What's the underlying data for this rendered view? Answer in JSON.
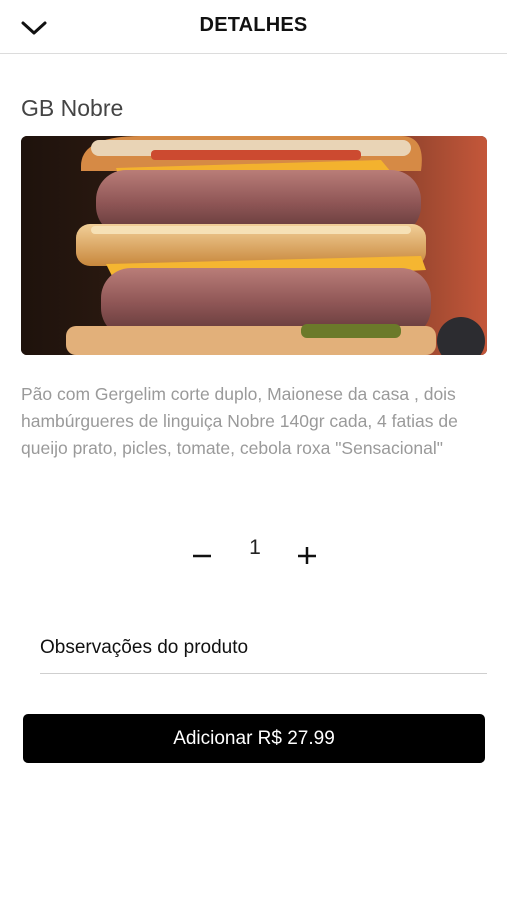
{
  "header": {
    "title": "DETALHES",
    "back_icon": "chevron-down-icon"
  },
  "product": {
    "name": "GB Nobre",
    "image_alt": "burger-photo",
    "description": "Pão com Gergelim corte duplo, Maionese da casa , dois hambúrgueres de linguiça Nobre 140gr cada, 4 fatias de queijo prato, picles, tomate, cebola roxa \"Sensacional\""
  },
  "quantity": {
    "minus_icon": "minus-icon",
    "value": "1",
    "plus_icon": "plus-icon"
  },
  "notes": {
    "placeholder": "Observações do produto",
    "value": ""
  },
  "cta": {
    "label": "Adicionar R$ 27.99",
    "background": "#000000",
    "text_color": "#ffffff"
  }
}
